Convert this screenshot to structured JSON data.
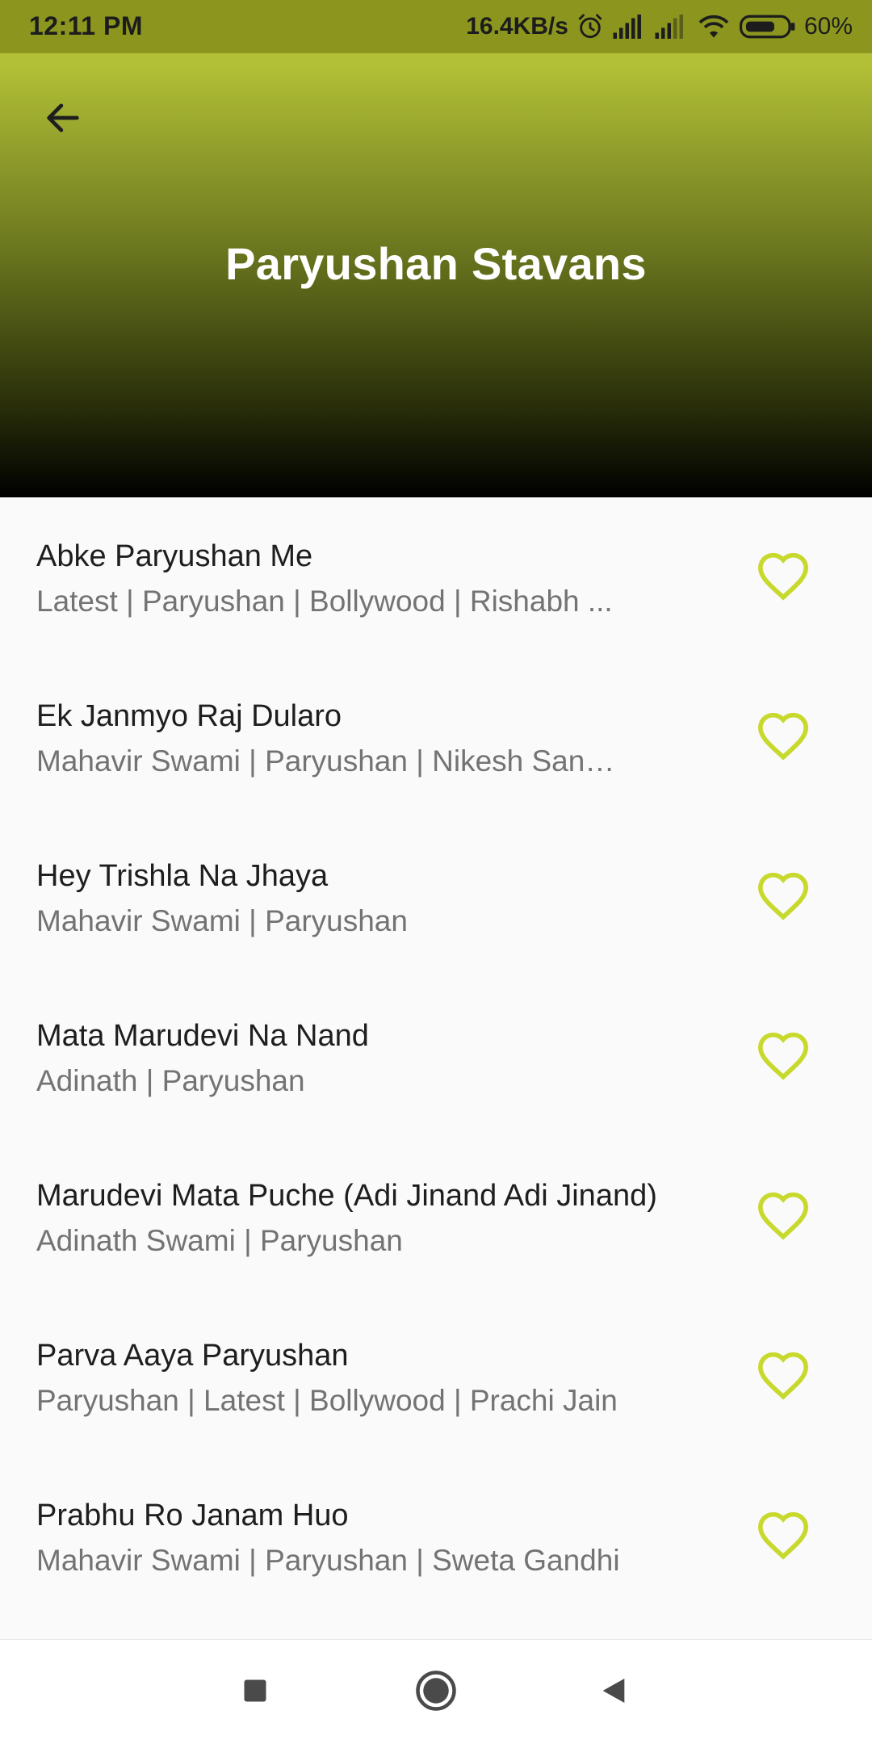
{
  "status_bar": {
    "time": "12:11 PM",
    "network_speed": "16.4KB/s",
    "battery_percent": "60%",
    "icons": [
      "alarm-icon",
      "signal-icon",
      "signal-icon",
      "wifi-icon",
      "battery-icon"
    ]
  },
  "header": {
    "title": "Paryushan Stavans",
    "back_icon": "arrow-left-icon"
  },
  "colors": {
    "accent": "#c8d92e",
    "header_top": "#b8c43a",
    "header_bottom": "#000000"
  },
  "songs": [
    {
      "title": "Abke Paryushan Me",
      "subtitle": "Latest | Paryushan | Bollywood | Rishabh ...",
      "favorite_icon": "heart-outline-icon"
    },
    {
      "title": "Ek Janmyo Raj Dularo",
      "subtitle": "Mahavir Swami | Paryushan | Nikesh Sanghvi",
      "favorite_icon": "heart-outline-icon"
    },
    {
      "title": "Hey Trishla Na Jhaya",
      "subtitle": "Mahavir Swami | Paryushan",
      "favorite_icon": "heart-outline-icon"
    },
    {
      "title": "Mata Marudevi Na Nand",
      "subtitle": "Adinath | Paryushan",
      "favorite_icon": "heart-outline-icon"
    },
    {
      "title": "Marudevi Mata Puche (Adi Jinand Adi Jinand)",
      "subtitle": "Adinath Swami | Paryushan",
      "favorite_icon": "heart-outline-icon"
    },
    {
      "title": "Parva Aaya Paryushan",
      "subtitle": "Paryushan | Latest | Bollywood | Prachi Jain",
      "favorite_icon": "heart-outline-icon"
    },
    {
      "title": "Prabhu Ro Janam Huo",
      "subtitle": "Mahavir Swami | Paryushan | Sweta Gandhi",
      "favorite_icon": "heart-outline-icon"
    }
  ],
  "nav_bar": {
    "icons": [
      "recents-icon",
      "home-icon",
      "back-icon"
    ]
  }
}
